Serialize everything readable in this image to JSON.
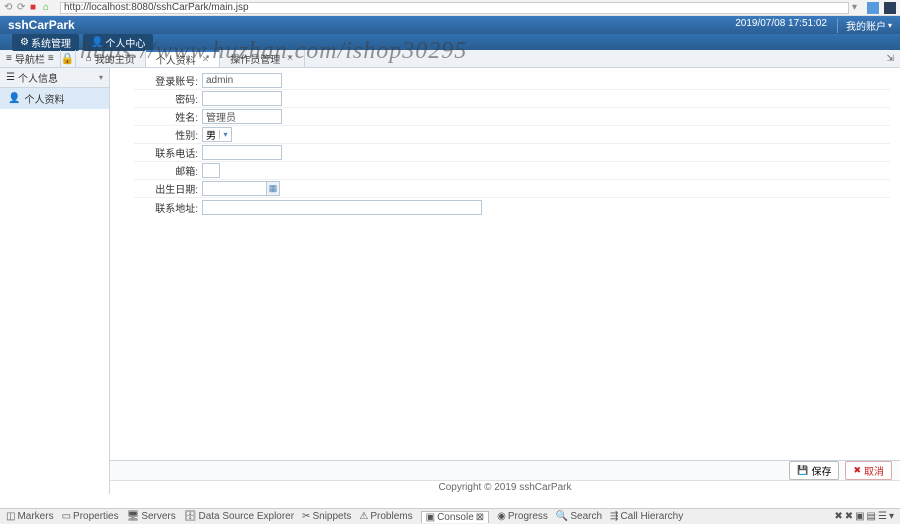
{
  "browser": {
    "url": "http://localhost:8080/sshCarPark/main.jsp"
  },
  "header": {
    "title": "sshCarPark",
    "time": "2019/07/08 17:51:02",
    "account": "我的账户"
  },
  "menu": {
    "btn1": "系统管理",
    "btn2": "个人中心"
  },
  "navrow": {
    "label": "导航栏"
  },
  "tabs": [
    {
      "label": "我的主页"
    },
    {
      "label": "个人资料"
    },
    {
      "label": "操作员管理"
    }
  ],
  "sidebar": {
    "header": "个人信息",
    "items": [
      "个人资料"
    ]
  },
  "form": {
    "labels": {
      "login": "登录账号:",
      "pwd": "密码:",
      "name": "姓名:",
      "sex": "性别:",
      "phone": "联系电话:",
      "email": "邮箱:",
      "birth": "出生日期:",
      "addr": "联系地址:"
    },
    "values": {
      "login": "admin",
      "name": "管理员",
      "sex": "男"
    }
  },
  "buttons": {
    "save": "保存",
    "cancel": "取消"
  },
  "footer": "Copyright © 2019 sshCarPark",
  "ide": {
    "tabs": [
      "Markers",
      "Properties",
      "Servers",
      "Data Source Explorer",
      "Snippets",
      "Problems",
      "Console",
      "Progress",
      "Search",
      "Call Hierarchy"
    ]
  },
  "watermark": "https://www.huzhan.com/ishop30295"
}
